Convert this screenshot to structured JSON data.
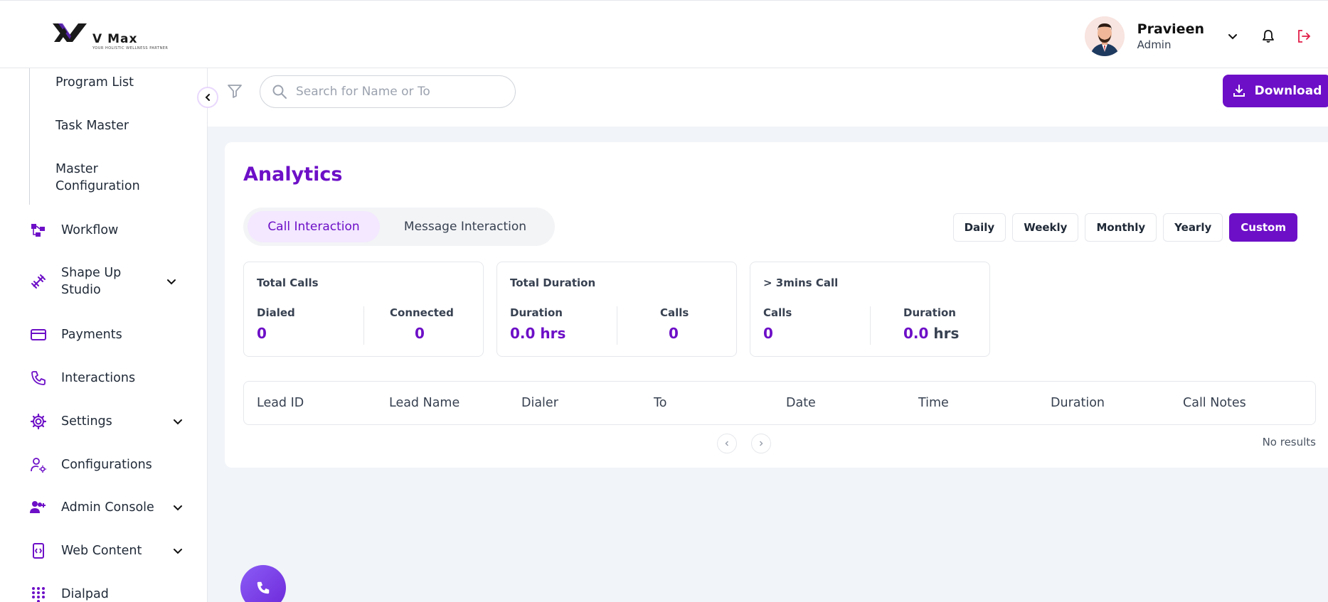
{
  "brand": {
    "name": "V Max",
    "tagline": "YOUR HOLISTIC WELLNESS PARTNER",
    "accent": "#6d0fc7"
  },
  "user": {
    "name": "Pravieen",
    "role": "Admin"
  },
  "sidebar": {
    "sub_items": [
      "Program List",
      "Task Master",
      "Master Configuration"
    ],
    "items": [
      {
        "label": "Workflow",
        "icon": "workflow-icon"
      },
      {
        "label": "Shape Up Studio",
        "icon": "dumbbell-icon"
      },
      {
        "label": "Payments",
        "icon": "credit-card-icon"
      },
      {
        "label": "Interactions",
        "icon": "phone-icon"
      },
      {
        "label": "Settings",
        "icon": "gear-icon"
      },
      {
        "label": "Configurations",
        "icon": "user-gear-icon"
      },
      {
        "label": "Admin Console",
        "icon": "users-plus-icon"
      },
      {
        "label": "Web Content",
        "icon": "mobile-code-icon"
      },
      {
        "label": "Dialpad",
        "icon": "dialpad-icon"
      }
    ]
  },
  "toolbar": {
    "search_placeholder": "Search for Name or To",
    "download_label": "Download"
  },
  "analytics": {
    "title": "Analytics",
    "tabs": [
      "Call Interaction",
      "Message Interaction"
    ],
    "active_tab": "Call Interaction",
    "ranges": [
      "Daily",
      "Weekly",
      "Monthly",
      "Yearly",
      "Custom"
    ],
    "active_range": "Custom",
    "stats": [
      {
        "title": "Total Calls",
        "cols": [
          {
            "label": "Dialed",
            "value": "0"
          },
          {
            "label": "Connected",
            "value": "0"
          }
        ]
      },
      {
        "title": "Total Duration",
        "cols": [
          {
            "label": "Duration",
            "value": "0.0 hrs"
          },
          {
            "label": "Calls",
            "value": "0"
          }
        ]
      },
      {
        "title": "> 3mins Call",
        "cols": [
          {
            "label": "Calls",
            "value": "0"
          },
          {
            "label": "Duration",
            "value": "0.0",
            "unit": "hrs"
          }
        ]
      }
    ],
    "table_headers": [
      "Lead ID",
      "Lead Name",
      "Dialer",
      "To",
      "Date",
      "Time",
      "Duration",
      "Call Notes"
    ],
    "empty_text": "No results"
  }
}
